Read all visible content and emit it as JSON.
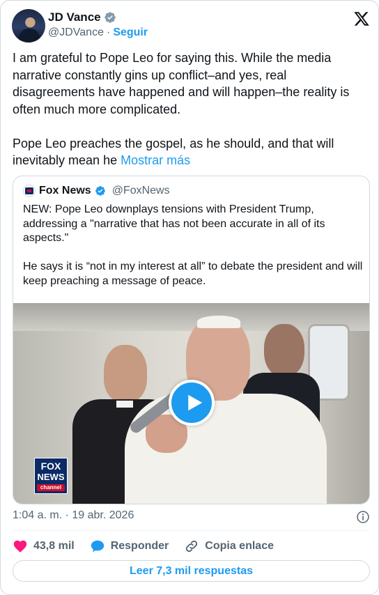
{
  "author": {
    "name": "JD Vance",
    "handle": "@JDVance",
    "separator": "·",
    "follow_label": "Seguir"
  },
  "tweet": {
    "text": "I am grateful to Pope Leo for saying this. While the media narrative constantly gins up conflict–and yes, real disagreements have happened and will happen–the reality is often much more complicated.\n\nPope Leo preaches the gospel, as he should, and that will inevitably mean he ",
    "show_more": "Mostrar más"
  },
  "quote": {
    "name": "Fox News",
    "handle": "@FoxNews",
    "text": "NEW: Pope Leo downplays tensions with President Trump, addressing a \"narrative that has not been accurate in all of its aspects.\"\n\nHe says it is “not in my interest at all” to debate the president and will keep preaching a message of peace.",
    "media": {
      "logo_line1": "FOX",
      "logo_line2": "NEWS",
      "logo_line3": "channel"
    }
  },
  "meta": {
    "timestamp": "1:04 a. m. · 19 abr. 2026"
  },
  "actions": {
    "likes": "43,8 mil",
    "reply_label": "Responder",
    "copy_link_label": "Copia enlace"
  },
  "read_replies_label": "Leer 7,3 mil respuestas",
  "colors": {
    "accent": "#1d9bf0",
    "like": "#f91880",
    "text": "#0f1419",
    "muted": "#536471"
  },
  "icons": [
    "verified-badge-icon",
    "x-logo-icon",
    "play-icon",
    "info-icon",
    "heart-icon",
    "reply-bubble-icon",
    "link-icon"
  ]
}
